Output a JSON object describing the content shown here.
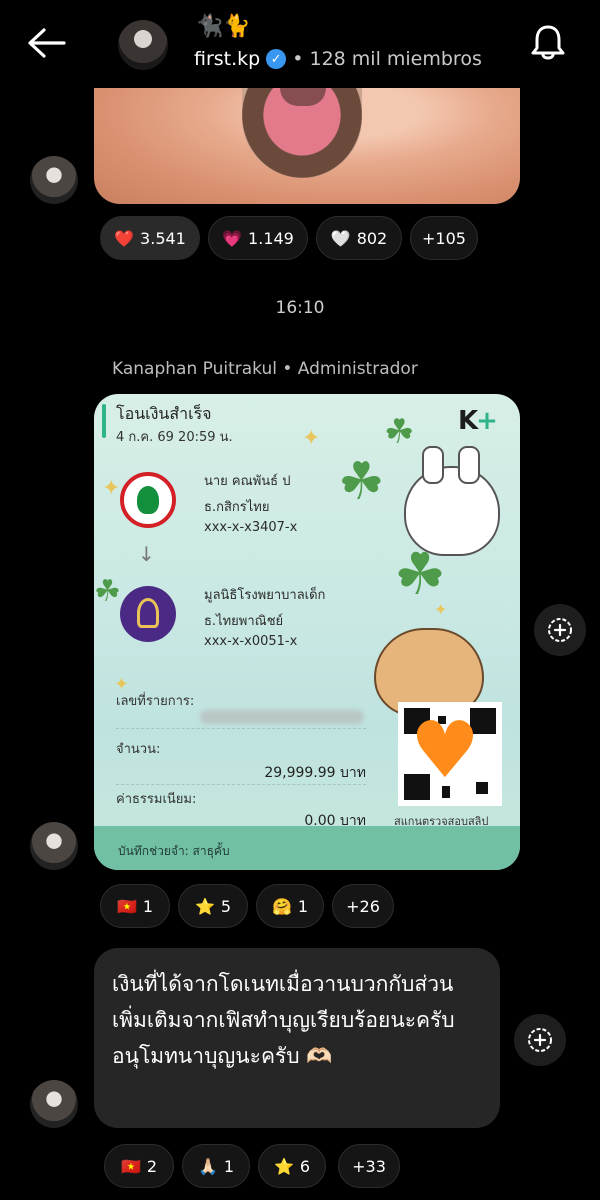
{
  "header": {
    "cats": "🐈‍⬛🐈",
    "channel_name": "first.kp",
    "members": "• 128 mil miembros"
  },
  "message1": {
    "reactions": [
      {
        "emoji": "❤️",
        "count": "3.541"
      },
      {
        "emoji": "💗",
        "count": "1.149"
      },
      {
        "emoji": "🤍",
        "count": "802"
      },
      {
        "emoji": "",
        "count": "+105"
      }
    ]
  },
  "time": "16:10",
  "sender": "Kanaphan Puitrakul • Administrador",
  "slip": {
    "title": "โอนเงินสำเร็จ",
    "date": "4 ก.ค. 69  20:59 น.",
    "brand": "K",
    "from_name": "นาย คณพันธ์ ป",
    "from_bank": "ธ.กสิกรไทย",
    "from_acct": "xxx-x-x3407-x",
    "to_name": "มูลนิธิโรงพยาบาลเด็ก",
    "to_bank": "ธ.ไทยพาณิชย์",
    "to_acct": "xxx-x-x0051-x",
    "ref_label": "เลขที่รายการ:",
    "amount_label": "จำนวน:",
    "amount": "29,999.99 บาท",
    "fee_label": "ค่าธรรมเนียม:",
    "fee": "0.00 บาท",
    "qr_caption": "สแกนตรวจสอบสลิป",
    "note": "บันทึกช่วยจำ: สาธุคั้บ"
  },
  "message2": {
    "reactions": [
      {
        "emoji": "🇻🇳",
        "count": "1"
      },
      {
        "emoji": "⭐",
        "count": "5"
      },
      {
        "emoji": "🤗",
        "count": "1"
      },
      {
        "emoji": "",
        "count": "+26"
      }
    ]
  },
  "message3": {
    "text": "เงินที่ได้จากโดเนทเมื่อวานบวกกับส่วนเพิ่มเติมจากเฟิสทำบุญเรียบร้อยนะครับ อนุโมทนาบุญนะครับ 🫶🏻",
    "reactions": [
      {
        "emoji": "🇻🇳",
        "count": "2"
      },
      {
        "emoji": "🙏🏻",
        "count": "1"
      },
      {
        "emoji": "⭐",
        "count": "6"
      },
      {
        "emoji": "",
        "count": "+33"
      }
    ]
  }
}
